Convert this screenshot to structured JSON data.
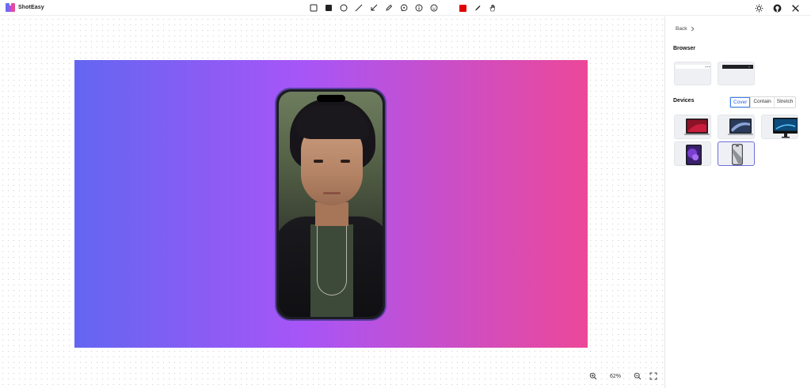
{
  "app": {
    "name": "ShotEasy"
  },
  "toolbar": {
    "tools": [
      {
        "name": "rectangle-outline-icon"
      },
      {
        "name": "rectangle-filled-icon"
      },
      {
        "name": "circle-icon"
      },
      {
        "name": "line-icon"
      },
      {
        "name": "arrow-icon"
      },
      {
        "name": "pencil-icon"
      },
      {
        "name": "speech-bubble-icon"
      },
      {
        "name": "info-icon"
      },
      {
        "name": "emoji-icon"
      }
    ],
    "current_color": "#e00000",
    "extra_tools": [
      {
        "name": "brush-icon"
      },
      {
        "name": "hand-icon"
      }
    ],
    "right_icons": [
      {
        "name": "sun-icon"
      },
      {
        "name": "github-icon"
      },
      {
        "name": "x-twitter-icon"
      }
    ]
  },
  "canvas": {
    "gradient": {
      "from": "#6366f1",
      "via": "#a855f7",
      "to": "#ec4899"
    },
    "frame_color": "#5b3fa0"
  },
  "zoom": {
    "value": "62%"
  },
  "panel": {
    "back_label": "Back",
    "browser_title": "Browser",
    "devices_title": "Devices",
    "fit_options": [
      "Cover",
      "Contain",
      "Stretch"
    ],
    "active_fit": "Cover",
    "browser_frames": [
      {
        "name": "browser-light-frame"
      },
      {
        "name": "browser-dark-frame"
      }
    ],
    "device_frames": [
      {
        "name": "macbook-pro-frame"
      },
      {
        "name": "macbook-air-frame"
      },
      {
        "name": "imac-frame"
      },
      {
        "name": "ipad-frame"
      },
      {
        "name": "iphone-frame",
        "selected": true
      }
    ]
  }
}
